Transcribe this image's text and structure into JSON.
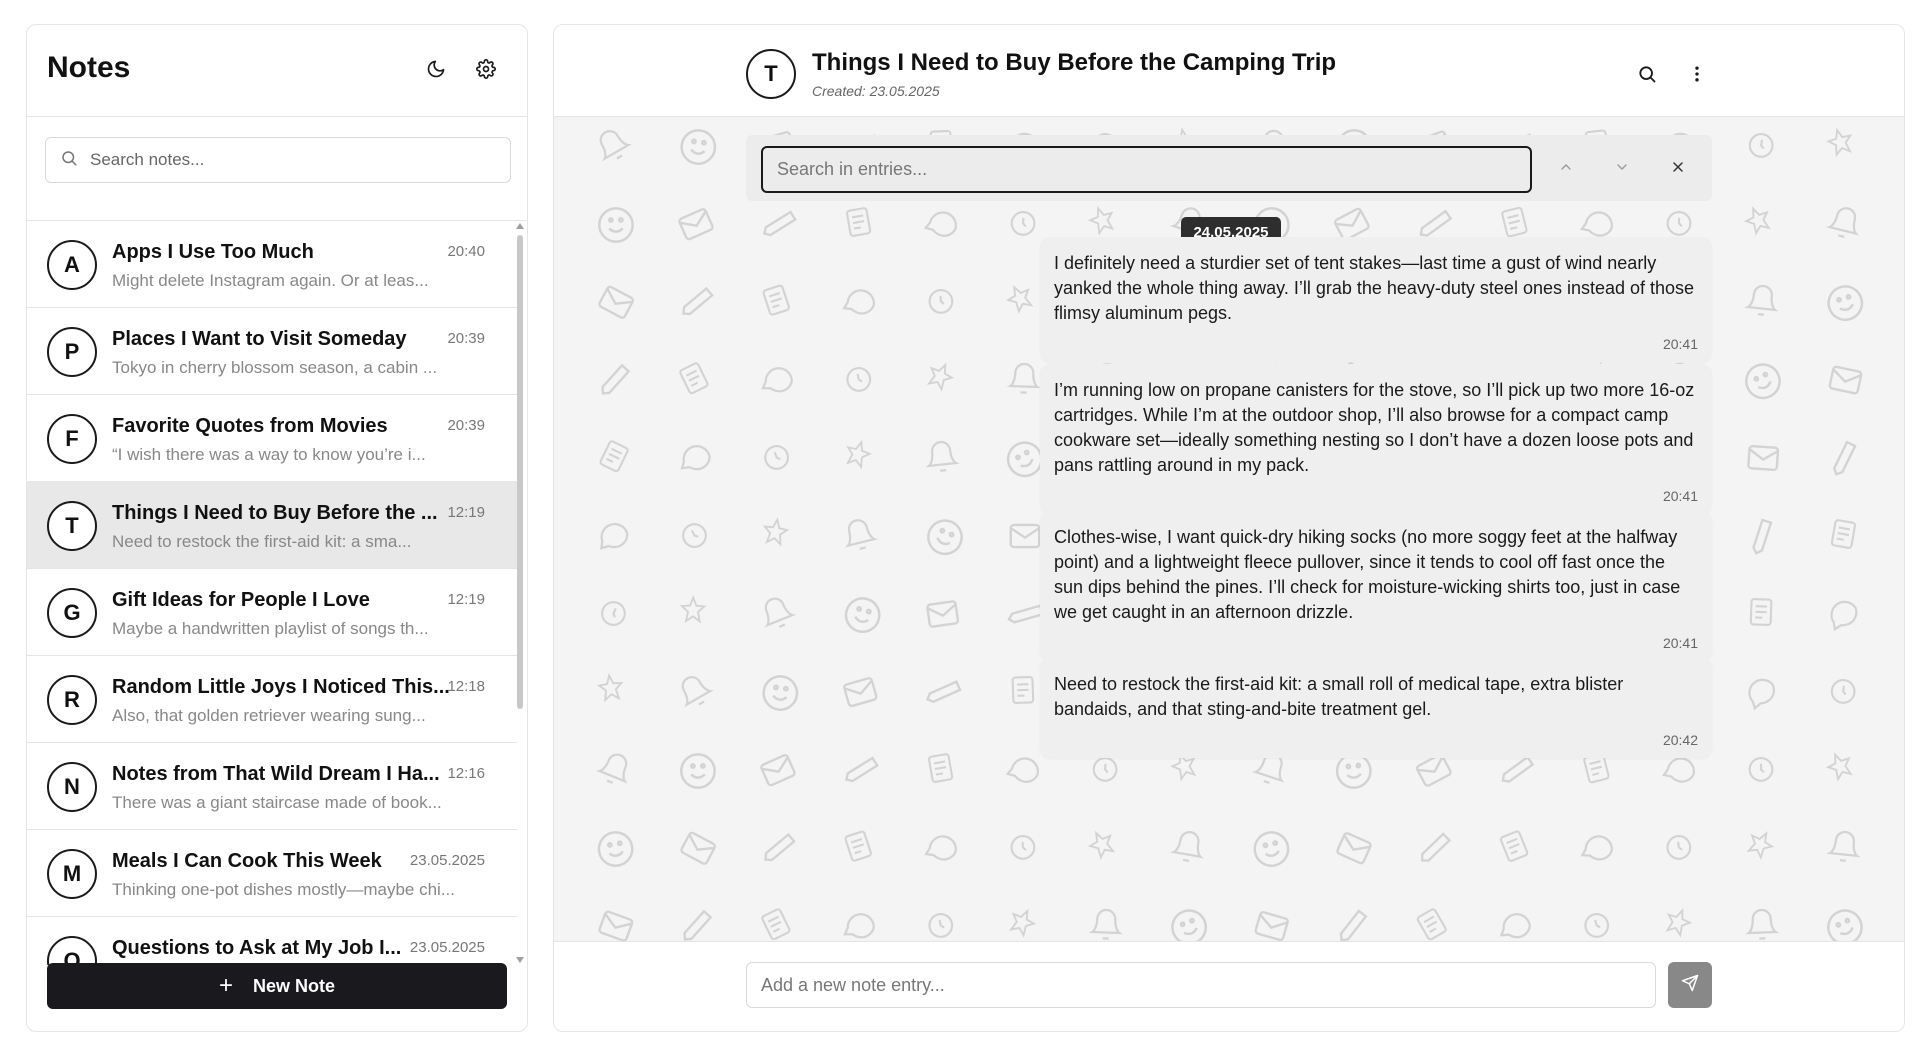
{
  "sidebar": {
    "title": "Notes",
    "theme_icon": "moon-icon",
    "settings_icon": "gear-icon",
    "search": {
      "placeholder": "Search notes...",
      "value": "",
      "icon": "search-icon"
    },
    "new_note_label": "New Note",
    "notes": [
      {
        "initial": "A",
        "title": "Apps I Use Too Much",
        "time": "20:40",
        "preview": "Might delete Instagram again. Or at leas...",
        "active": false
      },
      {
        "initial": "P",
        "title": "Places I Want to Visit Someday",
        "time": "20:39",
        "preview": "Tokyo in cherry blossom season, a cabin ...",
        "active": false
      },
      {
        "initial": "F",
        "title": "Favorite Quotes from Movies",
        "time": "20:39",
        "preview": "“I wish there was a way to know you’re i...",
        "active": false
      },
      {
        "initial": "T",
        "title": "Things I Need to Buy Before the ...",
        "time": "12:19",
        "preview": "Need to restock the first-aid kit: a sma...",
        "active": true
      },
      {
        "initial": "G",
        "title": "Gift Ideas for People I Love",
        "time": "12:19",
        "preview": "Maybe a handwritten playlist of songs th...",
        "active": false
      },
      {
        "initial": "R",
        "title": "Random Little Joys I Noticed This...",
        "time": "12:18",
        "preview": "Also, that golden retriever wearing sung...",
        "active": false
      },
      {
        "initial": "N",
        "title": "Notes from That Wild Dream I Ha...",
        "time": "12:16",
        "preview": "There was a giant staircase made of book...",
        "active": false
      },
      {
        "initial": "M",
        "title": "Meals I Can Cook This Week",
        "time": "23.05.2025",
        "preview": "Thinking one-pot dishes mostly—maybe chi...",
        "active": false
      },
      {
        "initial": "Q",
        "title": "Questions to Ask at My Job I...",
        "time": "23.05.2025",
        "preview": "",
        "active": false
      }
    ]
  },
  "main": {
    "avatar_initial": "T",
    "title": "Things I Need to Buy Before the Camping Trip",
    "created": "Created: 23.05.2025",
    "header_icons": [
      "search-icon",
      "more-vertical-icon"
    ],
    "entry_search": {
      "placeholder": "Search in entries...",
      "value": ""
    },
    "date_badge": "24.05.2025",
    "entries": [
      {
        "text": "I definitely need a sturdier set of tent stakes—last time a gust of wind nearly yanked the whole thing away. I’ll grab the heavy-duty steel ones instead of those flimsy aluminum pegs.",
        "time": "20:41"
      },
      {
        "text": "I’m running low on propane canisters for the stove, so I’ll pick up two more 16-oz cartridges. While I’m at the outdoor shop, I’ll also browse for a compact camp cookware set—ideally something nesting so I don’t have a dozen loose pots and pans rattling around in my pack.",
        "time": "20:41"
      },
      {
        "text": "Clothes-wise, I want quick-dry hiking socks (no more soggy feet at the halfway point) and a lightweight fleece pullover, since it tends to cool off fast once the sun dips behind the pines. I’ll check for moisture-wicking shirts too, just in case we get caught in an afternoon drizzle.",
        "time": "20:41"
      },
      {
        "text": "Need to restock the first-aid kit: a small roll of medical tape, extra blister bandaids, and that sting-and-bite treatment gel.",
        "time": "20:42"
      }
    ],
    "composer": {
      "placeholder": "Add a new note entry...",
      "value": "",
      "send_icon": "send-icon"
    }
  }
}
